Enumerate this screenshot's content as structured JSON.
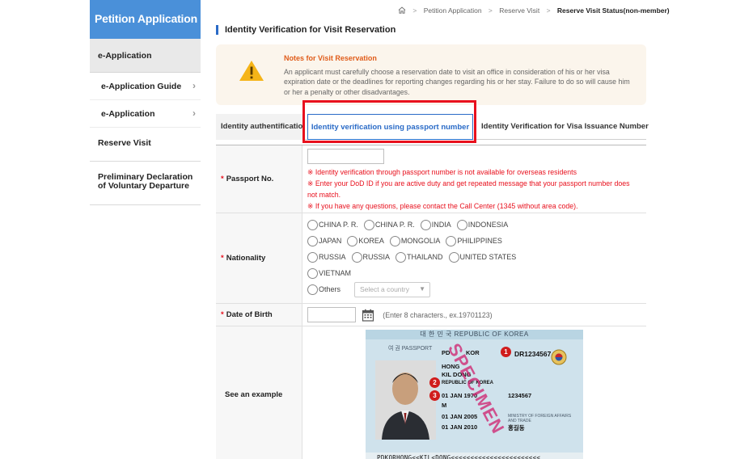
{
  "sidebar": {
    "title": "Petition Application",
    "section": "e-Application",
    "subitems": [
      {
        "label": "e-Application Guide"
      },
      {
        "label": "e-Application"
      }
    ],
    "items": [
      {
        "label": "Reserve Visit"
      },
      {
        "label": "Preliminary Declaration of Voluntary Departure"
      }
    ],
    "chevron": "›"
  },
  "breadcrumb": {
    "items": [
      "Petition Application",
      "Reserve Visit"
    ],
    "current": "Reserve Visit Status(non-member)",
    "separator": ">"
  },
  "page_title": "Identity Verification for Visit Reservation",
  "notice": {
    "title": "Notes for Visit Reservation",
    "text": "An applicant must carefully choose a reservation date to visit an office in consideration of his or her visa expiration date or the deadlines for reporting changes regarding his or her stay. Failure to do so will cause him or her a penalty or other disadvantages.",
    "icon": "warning-icon"
  },
  "tabs": [
    {
      "label": "Identity authentification"
    },
    {
      "label": "Identity verification using passport number",
      "active": true
    },
    {
      "label": "Identity Verification for Visa Issuance Number"
    }
  ],
  "form": {
    "passport": {
      "required_mark": "*",
      "label": "Passport No.",
      "value": "",
      "messages": [
        "※ Identity verification through passport number is not available for overseas residents",
        "※ Enter your DoD ID if you are active duty and get repeated message that your passport number does not match.",
        "※ If you have any questions, please contact the Call Center (1345 without area code)."
      ]
    },
    "nationality": {
      "required_mark": "*",
      "label": "Nationality",
      "rows": [
        [
          "CHINA P. R.",
          "CHINA P. R.",
          "INDIA",
          "INDONESIA"
        ],
        [
          "JAPAN",
          "KOREA",
          "MONGOLIA",
          "PHILIPPINES"
        ],
        [
          "RUSSIA",
          "RUSSIA",
          "THAILAND",
          "UNITED STATES"
        ],
        [
          "VIETNAM"
        ]
      ],
      "others_label": "Others",
      "select_placeholder": "Select a country"
    },
    "dob": {
      "required_mark": "*",
      "label": "Date of Birth",
      "value": "",
      "hint": "(Enter 8 characters., ex.19701123)"
    },
    "example": {
      "label": "See an example"
    }
  },
  "passport_sample": {
    "header": "대 한 민 국   REPUBLIC OF KOREA",
    "doc_label": "여 권  PASSPORT",
    "type": "PD",
    "country": "KOR",
    "passport_no": "DR1234567",
    "surname": "HONG",
    "given_name": "KIL DONG",
    "nationality": "REPUBLIC OF KOREA",
    "dob": "01 JAN 1970",
    "sex": "M",
    "personal_no": "1234567",
    "issue_date": "01 JAN 2005",
    "expiry_date": "01 JAN 2010",
    "authority": "MINISTRY OF FOREIGN AFFAIRS AND TRADE",
    "signature": "홍길동",
    "stamp": "SPECIMEN",
    "mrz": "PDKORHONG<<KIL<DONG<<<<<<<<<<<<<<<<<<<<<<<",
    "badges": [
      "1",
      "2",
      "3"
    ]
  }
}
